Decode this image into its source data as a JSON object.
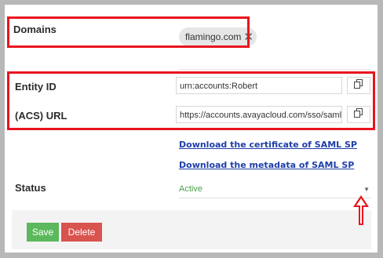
{
  "domains": {
    "label": "Domains",
    "chip_text": "flamingo.com",
    "chip_remove": "✕"
  },
  "entity_id": {
    "label": "Entity ID",
    "value": "urn:accounts:Robert",
    "copy_icon": "copy-icon"
  },
  "acs_url": {
    "label": "(ACS) URL",
    "value": "https://accounts.avayacloud.com/sso/saml/Robe",
    "copy_icon": "copy-icon"
  },
  "links": {
    "certificate": "Download the certificate of SAML SP",
    "metadata": "Download the metadata of SAML SP"
  },
  "status": {
    "label": "Status",
    "value": "Active",
    "value_color": "#4aa04a"
  },
  "buttons": {
    "save": "Save",
    "delete": "Delete"
  },
  "colors": {
    "highlight": "#e8141e",
    "save": "#5cb85c",
    "delete": "#d9534f",
    "link": "#1f3ea8"
  }
}
